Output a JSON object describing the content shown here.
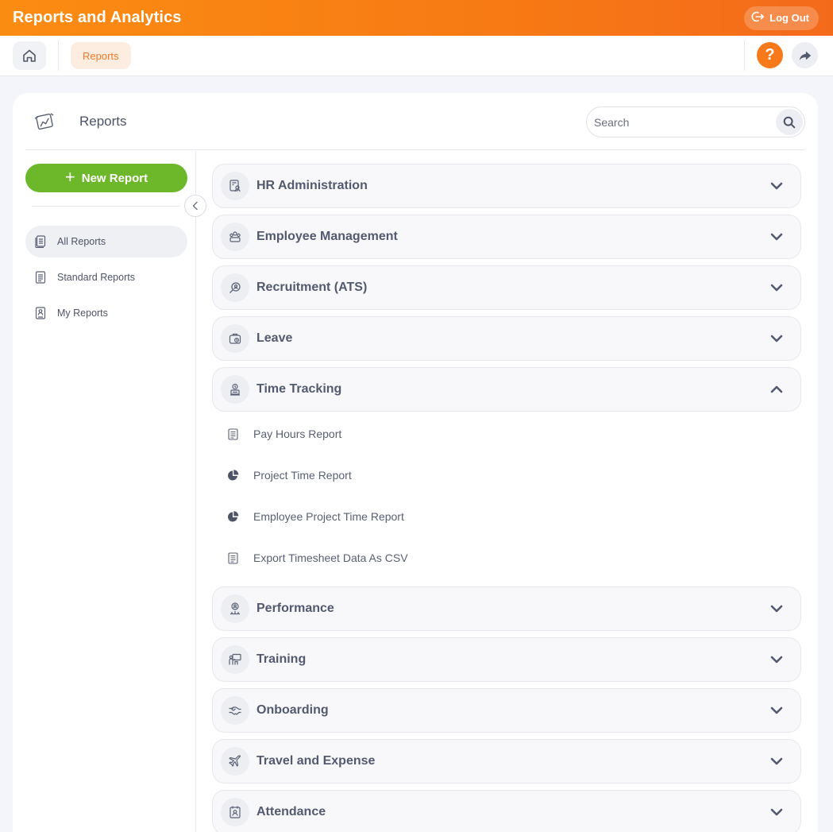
{
  "app": {
    "title": "Reports and Analytics",
    "logout_label": "Log Out"
  },
  "breadcrumb": {
    "current": "Reports"
  },
  "header": {
    "help_symbol": "?"
  },
  "card": {
    "title": "Reports",
    "search_placeholder": "Search"
  },
  "sidebar": {
    "new_report_label": "New Report",
    "items": [
      {
        "label": "All Reports",
        "icon": "all-reports-icon",
        "active": true
      },
      {
        "label": "Standard Reports",
        "icon": "standard-reports-icon",
        "active": false
      },
      {
        "label": "My Reports",
        "icon": "my-reports-icon",
        "active": false
      }
    ]
  },
  "categories": [
    {
      "label": "HR Administration",
      "icon": "hr-admin-icon",
      "expanded": false
    },
    {
      "label": "Employee Management",
      "icon": "employee-management-icon",
      "expanded": false
    },
    {
      "label": "Recruitment (ATS)",
      "icon": "recruitment-icon",
      "expanded": false
    },
    {
      "label": "Leave",
      "icon": "leave-icon",
      "expanded": false
    },
    {
      "label": "Time Tracking",
      "icon": "time-tracking-icon",
      "expanded": true,
      "reports": [
        {
          "label": "Pay Hours Report",
          "icon": "document-icon"
        },
        {
          "label": "Project Time Report",
          "icon": "pie-chart-icon"
        },
        {
          "label": "Employee Project Time Report",
          "icon": "pie-chart-icon"
        },
        {
          "label": "Export Timesheet Data As CSV",
          "icon": "document-icon"
        }
      ]
    },
    {
      "label": "Performance",
      "icon": "performance-icon",
      "expanded": false
    },
    {
      "label": "Training",
      "icon": "training-icon",
      "expanded": false
    },
    {
      "label": "Onboarding",
      "icon": "onboarding-icon",
      "expanded": false
    },
    {
      "label": "Travel and Expense",
      "icon": "travel-icon",
      "expanded": false
    },
    {
      "label": "Attendance",
      "icon": "attendance-icon",
      "expanded": false
    }
  ],
  "colors": {
    "brand_orange": "#f77a14",
    "new_report_green": "#6db82a",
    "crumb_bg": "#fdece0",
    "text_primary": "#535a70"
  }
}
